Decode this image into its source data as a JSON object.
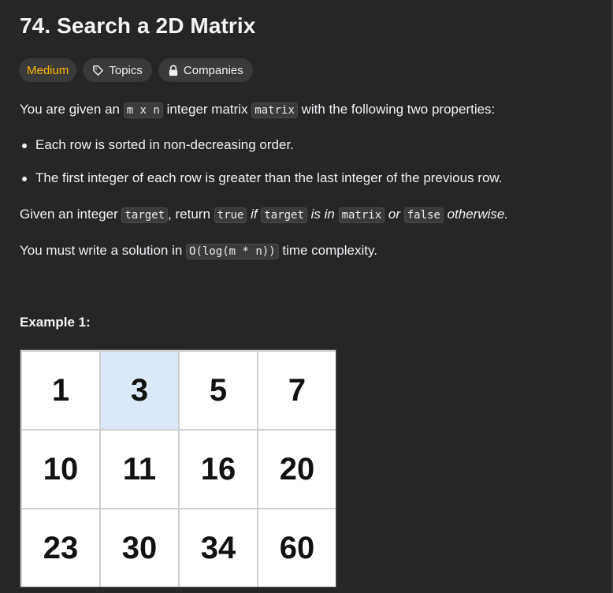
{
  "problem": {
    "title": "74. Search a 2D Matrix",
    "difficulty": "Medium",
    "topics_label": "Topics",
    "companies_label": "Companies"
  },
  "description": {
    "p1_a": "You are given an ",
    "p1_code1": "m x n",
    "p1_b": " integer matrix ",
    "p1_code2": "matrix",
    "p1_c": " with the following two properties:",
    "bullets": [
      "Each row is sorted in non-decreasing order.",
      "The first integer of each row is greater than the last integer of the previous row."
    ],
    "p2_a": "Given an integer ",
    "p2_code1": "target",
    "p2_b": ", return ",
    "p2_code2": "true",
    "p2_em1": " if ",
    "p2_code3": "target",
    "p2_em2": " is in ",
    "p2_code4": "matrix",
    "p2_em3": " or ",
    "p2_code5": "false",
    "p2_em4": " otherwise.",
    "p3_a": "You must write a solution in ",
    "p3_code": "O(log(m * n))",
    "p3_b": " time complexity."
  },
  "example": {
    "label": "Example 1:",
    "matrix": [
      [
        "1",
        "3",
        "5",
        "7"
      ],
      [
        "10",
        "11",
        "16",
        "20"
      ],
      [
        "23",
        "30",
        "34",
        "60"
      ]
    ],
    "highlight_color": "#dbe8f8"
  },
  "colors": {
    "background": "#262626",
    "difficulty_medium": "#ffb800"
  }
}
